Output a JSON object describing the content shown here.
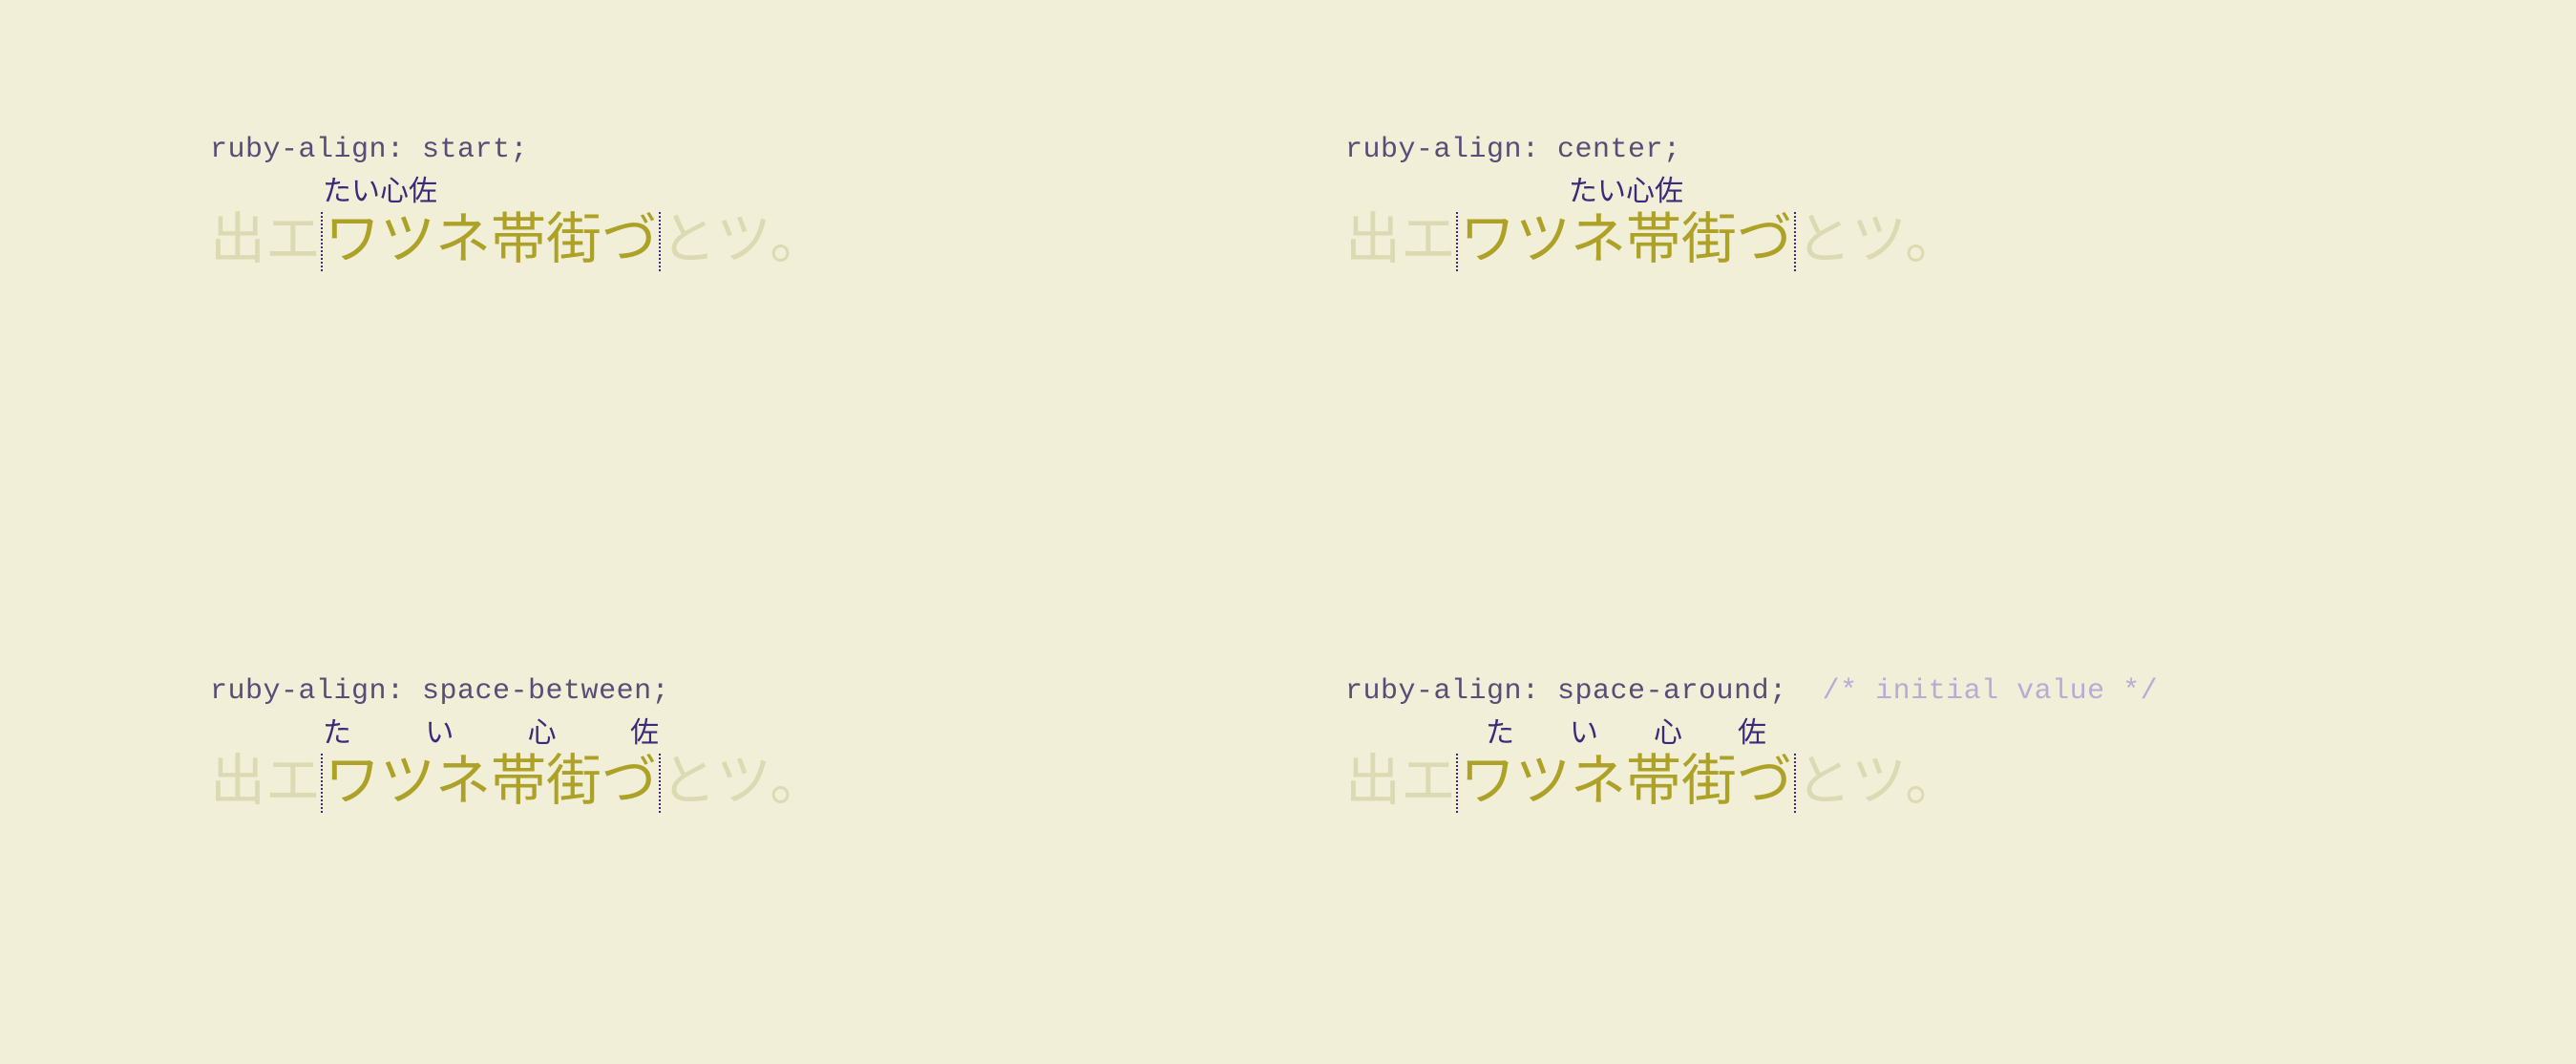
{
  "examples": [
    {
      "code": "ruby-align: start;",
      "comment": "",
      "align": "start"
    },
    {
      "code": "ruby-align: center;",
      "comment": "",
      "align": "center"
    },
    {
      "code": "ruby-align: space-between;",
      "comment": "",
      "align": "space-between"
    },
    {
      "code": "ruby-align: space-around;",
      "comment": "  /* initial value */",
      "align": "space-around"
    }
  ],
  "text": {
    "before": "出エ",
    "base": "ワツネ帯街づ",
    "after": "とツ。",
    "ruby": [
      "た",
      "い",
      "心",
      "佐"
    ]
  }
}
